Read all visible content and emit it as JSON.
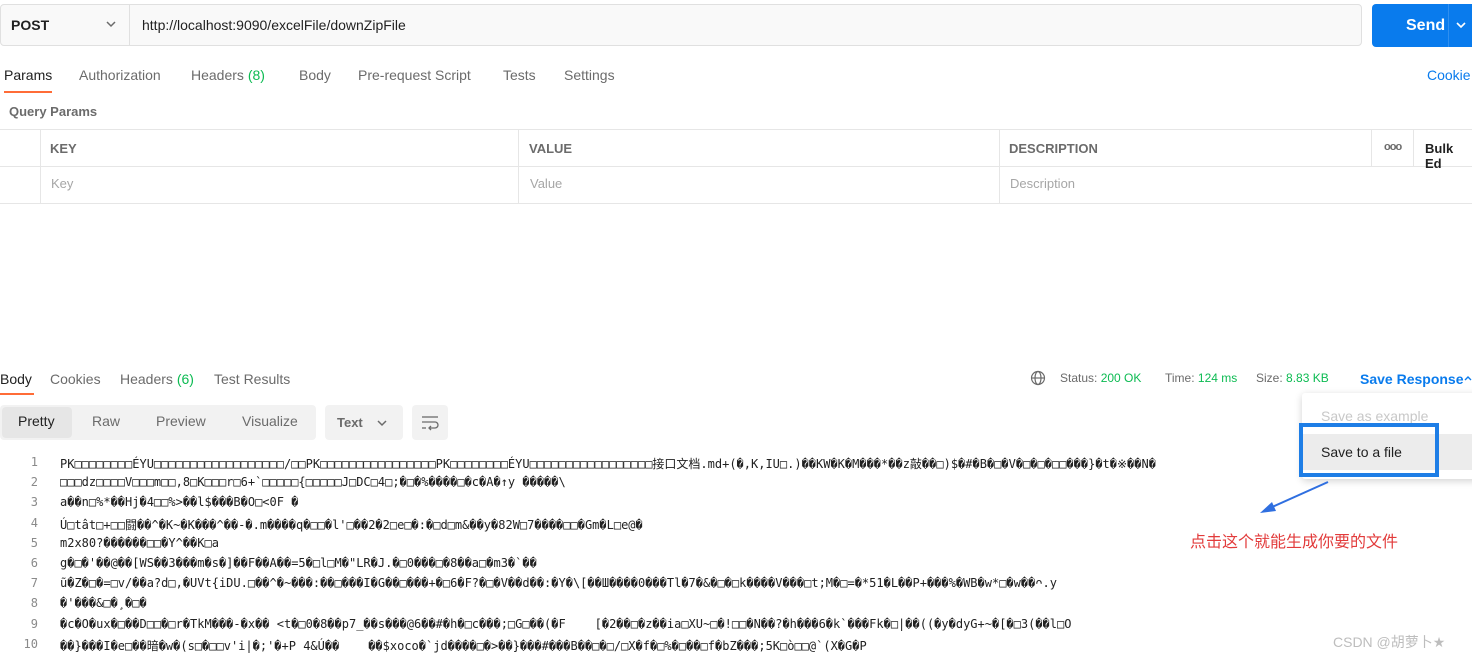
{
  "request": {
    "method": "POST",
    "url": "http://localhost:9090/excelFile/downZipFile",
    "send_label": "Send"
  },
  "request_tabs": {
    "params": "Params",
    "authorization": "Authorization",
    "headers": "Headers",
    "headers_count": "(8)",
    "body": "Body",
    "pre_request": "Pre-request Script",
    "tests": "Tests",
    "settings": "Settings",
    "cookies": "Cookie"
  },
  "query_params": {
    "title": "Query Params",
    "col_key": "KEY",
    "col_value": "VALUE",
    "col_description": "DESCRIPTION",
    "more": "ooo",
    "bulk_edit": "Bulk Ed",
    "ph_key": "Key",
    "ph_value": "Value",
    "ph_description": "Description"
  },
  "response_tabs": {
    "body": "Body",
    "cookies": "Cookies",
    "headers": "Headers",
    "headers_count": "(6)",
    "test_results": "Test Results"
  },
  "response_meta": {
    "status_label": "Status:",
    "status_value": "200 OK",
    "time_label": "Time:",
    "time_value": "124 ms",
    "size_label": "Size:",
    "size_value": "8.83 KB",
    "save_response": "Save Response"
  },
  "view_modes": {
    "pretty": "Pretty",
    "raw": "Raw",
    "preview": "Preview",
    "visualize": "Visualize",
    "format": "Text"
  },
  "code_lines": [
    {
      "n": "1",
      "text": "PK□□□□□□□□ÉYU□□□□□□□□□□□□□□□□□□/□□PK□□□□□□□□□□□□□□□□PK□□□□□□□□ÉYU□□□□□□□□□□□□□□□□□接口文档.md+(�,K,IU□.)��KW�K�M���*��z敲��□)$�#�B�□�V�□�□�□□���}�t�※��N�"
    },
    {
      "n": "2",
      "text": "□□□dz□□□□V□□□m□□,8□K□□□r□6+`□□□□□{□□□□□J□DC□4□;�□�%����□�c�A�↑y �����\\"
    },
    {
      "n": "3",
      "text": "a��n□%*��Hj�4□□%>��l$���B�O□<0F �"
    },
    {
      "n": "4",
      "text": "Ú□tât□+□□闘��^�K~�K���^��-�.m����q�□□�l'□��2�2□e□�:�□d□m&��y�82W□7����□□�Gm�L□e@�"
    },
    {
      "n": "5",
      "text": "m2x80?������□□�Y^��K□a"
    },
    {
      "n": "6",
      "text": "g�□�'��@��[WS��3���m�s�]��F��A��=5�□l□M�\"LR�J.�□0���□�8��a□�m3�`��"
    },
    {
      "n": "7",
      "text": "ũ�Z�□�=□v/��a?d□,�UVt{iDU.□��^�~���:��□���I�G��□���+�□6�F?�□�V��d��:�Y�\\[��Ш����0���Tl�7�&�□�□k����V���□t;M�□=�*51�L��P+���%�WB�w*□�w��ᴖ.y"
    },
    {
      "n": "8",
      "text": "�'���&□�¸�□�"
    },
    {
      "n": "9",
      "text": "�c�O�ux�□��D□□�□r�TkM���-�x�� <t�□0�8��p7_��s���@6��#�h�□c���;□G□��(�F    [�2��□�z��ia□XU~□�!□□�N��?�h���6�k`���Fk�□|��((�y�dyG+~�[�□3(��l□O"
    },
    {
      "n": "10",
      "text": "��}���I�e□��暗�w�(s□�□□v'i|�;'�+P 4&Ú��    ��$xoco�`jd����□�>��}���#���B��□�□/□X�f�□%�□��□f�bZ���;5K□ò□□@`(X�G�P"
    }
  ],
  "save_menu": {
    "save_as_example": "Save as example",
    "save_to_file": "Save to a file"
  },
  "annotation": "点击这个就能生成你要的文件",
  "watermark": "CSDN @胡萝卜★",
  "colors": {
    "accent": "#ff6c37",
    "send": "#097bed",
    "status_ok": "#0cbb52",
    "annotation": "#e23b3b",
    "highlight_box": "#1e7ee6"
  }
}
